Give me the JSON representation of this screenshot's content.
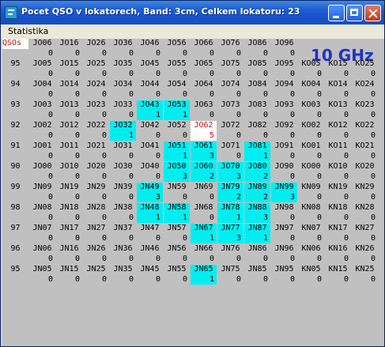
{
  "window": {
    "title": "Pocet QSO v lokatorech, Band: 3cm, Celkem lokatoru: 23"
  },
  "menu": {
    "items": [
      "Statistika"
    ]
  },
  "grid": {
    "header_label": "QSOs",
    "band_label": "10 GHz",
    "rows": [
      {
        "labels": [
          "",
          "JO06",
          "JO16",
          "JO26",
          "JO36",
          "JO46",
          "JO56",
          "JO66",
          "JO76",
          "JO86",
          "JO96",
          "",
          ""
        ],
        "counts": [
          "",
          "0",
          "0",
          "0",
          "0",
          "0",
          "0",
          "0",
          "0",
          "0",
          "0",
          "",
          ""
        ],
        "hl": []
      },
      {
        "labels": [
          "95",
          "JO05",
          "JO15",
          "JO25",
          "JO35",
          "JO45",
          "JO55",
          "JO65",
          "JO75",
          "JO85",
          "JO95",
          "KO05",
          "KO15",
          "KO25"
        ],
        "counts": [
          "",
          "0",
          "0",
          "0",
          "0",
          "0",
          "0",
          "0",
          "0",
          "0",
          "0",
          "0",
          "0",
          "0"
        ],
        "hl": []
      },
      {
        "labels": [
          "94",
          "JO04",
          "JO14",
          "JO24",
          "JO34",
          "JO44",
          "JO54",
          "JO64",
          "JO74",
          "JO84",
          "JO94",
          "KO04",
          "KO14",
          "KO24"
        ],
        "counts": [
          "",
          "0",
          "0",
          "0",
          "0",
          "0",
          "0",
          "0",
          "0",
          "0",
          "0",
          "0",
          "0",
          "0"
        ],
        "hl": []
      },
      {
        "labels": [
          "93",
          "JO03",
          "JO13",
          "JO23",
          "JO33",
          "JO43",
          "JO53",
          "JO63",
          "JO73",
          "JO83",
          "JO93",
          "KO03",
          "KO13",
          "KO23"
        ],
        "counts": [
          "",
          "0",
          "0",
          "0",
          "0",
          "1",
          "1",
          "0",
          "0",
          "0",
          "0",
          "0",
          "0",
          "0"
        ],
        "hl": [
          5,
          6
        ]
      },
      {
        "labels": [
          "92",
          "JO02",
          "JO12",
          "JO22",
          "JO32",
          "JO42",
          "JO52",
          "JO62",
          "JO72",
          "JO82",
          "JO92",
          "KO02",
          "KO12",
          "KO22"
        ],
        "counts": [
          "",
          "0",
          "0",
          "0",
          "1",
          "0",
          "0",
          "5",
          "0",
          "0",
          "0",
          "0",
          "0",
          "0"
        ],
        "hl": [
          4
        ],
        "sel": [
          7
        ]
      },
      {
        "labels": [
          "91",
          "JO01",
          "JO11",
          "JO21",
          "JO31",
          "JO41",
          "JO51",
          "JO61",
          "JO71",
          "JO81",
          "JO91",
          "KO01",
          "KO11",
          "KO21"
        ],
        "counts": [
          "",
          "0",
          "0",
          "0",
          "0",
          "0",
          "1",
          "3",
          "0",
          "1",
          "0",
          "0",
          "0",
          "0"
        ],
        "hl": [
          6,
          7,
          9
        ]
      },
      {
        "labels": [
          "90",
          "JO00",
          "JO10",
          "JO20",
          "JO30",
          "JO40",
          "JO50",
          "JO60",
          "JO70",
          "JO80",
          "JO90",
          "KO00",
          "KO10",
          "KO20"
        ],
        "counts": [
          "",
          "0",
          "0",
          "0",
          "0",
          "0",
          "3",
          "2",
          "3",
          "2",
          "0",
          "0",
          "0",
          "0"
        ],
        "hl": [
          6,
          7,
          8,
          9
        ]
      },
      {
        "labels": [
          "99",
          "JN09",
          "JN19",
          "JN29",
          "JN39",
          "JN49",
          "JN59",
          "JN69",
          "JN79",
          "JN89",
          "JN99",
          "KN09",
          "KN19",
          "KN29"
        ],
        "counts": [
          "",
          "0",
          "0",
          "0",
          "0",
          "3",
          "0",
          "0",
          "2",
          "2",
          "3",
          "0",
          "0",
          "0"
        ],
        "hl": [
          5,
          8,
          9,
          10
        ]
      },
      {
        "labels": [
          "98",
          "JN08",
          "JN18",
          "JN28",
          "JN38",
          "JN48",
          "JN58",
          "JN68",
          "JN78",
          "JN88",
          "JN98",
          "KN08",
          "KN18",
          "KN28"
        ],
        "counts": [
          "",
          "0",
          "0",
          "0",
          "0",
          "1",
          "1",
          "0",
          "1",
          "3",
          "0",
          "0",
          "0",
          "0"
        ],
        "hl": [
          5,
          6,
          8,
          9
        ]
      },
      {
        "labels": [
          "97",
          "JN07",
          "JN17",
          "JN27",
          "JN37",
          "JN47",
          "JN57",
          "JN67",
          "JN77",
          "JN87",
          "JN97",
          "KN07",
          "KN17",
          "KN27"
        ],
        "counts": [
          "",
          "0",
          "0",
          "0",
          "0",
          "0",
          "0",
          "1",
          "3",
          "1",
          "0",
          "0",
          "0",
          "0"
        ],
        "hl": [
          7,
          8,
          9
        ]
      },
      {
        "labels": [
          "96",
          "JN06",
          "JN16",
          "JN26",
          "JN36",
          "JN46",
          "JN56",
          "JN66",
          "JN76",
          "JN86",
          "JN96",
          "KN06",
          "KN16",
          "KN26"
        ],
        "counts": [
          "",
          "0",
          "0",
          "0",
          "0",
          "0",
          "0",
          "0",
          "0",
          "0",
          "0",
          "0",
          "0",
          "0"
        ],
        "hl": []
      },
      {
        "labels": [
          "95",
          "JN05",
          "JN15",
          "JN25",
          "JN35",
          "JN45",
          "JN55",
          "JN65",
          "JN75",
          "JN85",
          "JN95",
          "KN05",
          "KN15",
          "KN25"
        ],
        "counts": [
          "",
          "0",
          "0",
          "0",
          "0",
          "0",
          "0",
          "1",
          "0",
          "0",
          "0",
          "0",
          "0",
          "0"
        ],
        "hl": [
          7
        ]
      }
    ]
  }
}
